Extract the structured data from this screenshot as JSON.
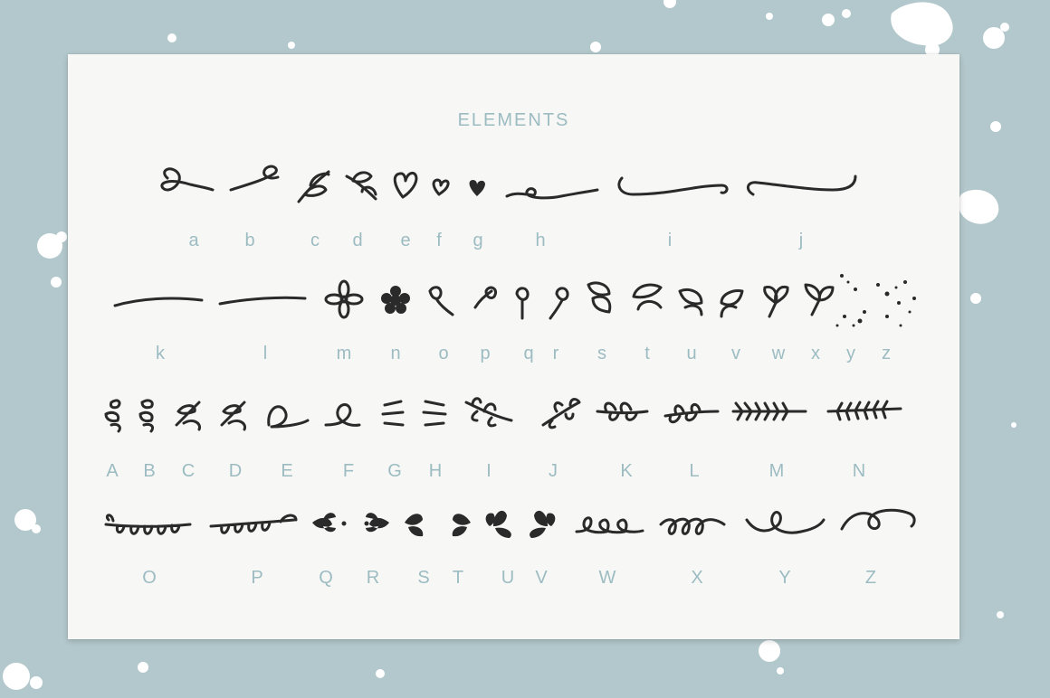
{
  "title": "ELEMENTS",
  "rows": [
    {
      "labels": [
        {
          "char": "a"
        },
        {
          "char": "b"
        },
        {
          "char": "c"
        },
        {
          "char": "d"
        },
        {
          "char": "e"
        },
        {
          "char": "f"
        },
        {
          "char": "g"
        },
        {
          "char": "h"
        },
        {
          "char": "i"
        },
        {
          "char": "j"
        }
      ]
    },
    {
      "labels": [
        {
          "char": "k"
        },
        {
          "char": "l"
        },
        {
          "char": "m"
        },
        {
          "char": "n"
        },
        {
          "char": "o"
        },
        {
          "char": "p"
        },
        {
          "char": "q"
        },
        {
          "char": "r"
        },
        {
          "char": "s"
        },
        {
          "char": "t"
        },
        {
          "char": "u"
        },
        {
          "char": "v"
        },
        {
          "char": "w"
        },
        {
          "char": "x"
        },
        {
          "char": "y"
        },
        {
          "char": "z"
        }
      ]
    },
    {
      "labels": [
        {
          "char": "A"
        },
        {
          "char": "B"
        },
        {
          "char": "C"
        },
        {
          "char": "D"
        },
        {
          "char": "E"
        },
        {
          "char": "F"
        },
        {
          "char": "G"
        },
        {
          "char": "H"
        },
        {
          "char": "I"
        },
        {
          "char": "J"
        },
        {
          "char": "K"
        },
        {
          "char": "L"
        },
        {
          "char": "M"
        },
        {
          "char": "N"
        }
      ]
    },
    {
      "labels": [
        {
          "char": "O"
        },
        {
          "char": "P"
        },
        {
          "char": "Q"
        },
        {
          "char": "R"
        },
        {
          "char": "S"
        },
        {
          "char": "T"
        },
        {
          "char": "U"
        },
        {
          "char": "V"
        },
        {
          "char": "W"
        },
        {
          "char": "X"
        },
        {
          "char": "Y"
        },
        {
          "char": "Z"
        }
      ]
    }
  ],
  "colors": {
    "background": "#b3c8cc",
    "card": "#f7f7f6",
    "label": "#9cbcc2",
    "ink": "#2a2a2a"
  }
}
